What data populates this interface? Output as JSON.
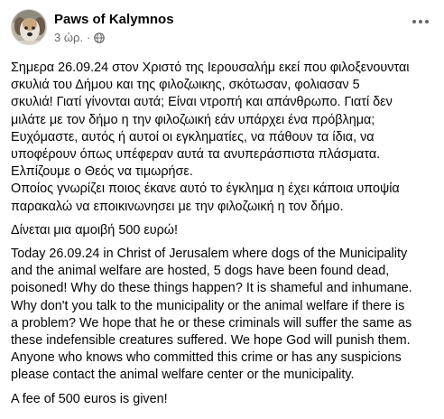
{
  "post": {
    "author": "Paws of Kalymnos",
    "time": "3 ώρ.",
    "separator": "·",
    "privacy_icon": "globe-icon",
    "more_icon": "more-options-icon",
    "paragraphs": [
      "Σημερα 26.09.24 στον Χριστό της Ιερουσαλήμ εκεί που φιλοξενουνται\nσκυλιά του Δήμου και της φιλοζωικης, σκότωσαν, φολιασαν 5\nσκυλιά! Γιατί γίνονται αυτά; Είναι ντροπή και απάνθρωπο. Γιατί δεν\nμιλάτε με τον δήμο η την φιλοζωική εάν υπάρχει ένα πρόβλημα;\nΕυχόμαστε, αυτός ή αυτοί οι εγκληματίες, να πάθουν τα ίδια, να\nυποφέρουν όπως υπέφεραν αυτά τα ανυπεράσπιστα πλάσματα.\nΕλπίζουμε ο Θεός να τιμωρήσε.\nΟποίος γνωρίζει ποιος έκανε αυτό το έγκλημα η έχει κάποια υποψία\nπαρακαλώ να εποικινωνησει με την φιλοζωική η τον δήμο.",
      "Δίνεται μια αμοιβή 500 ευρώ!",
      "Today 26.09.24 in Christ of Jerusalem where dogs of the Municipality\nand the animal welfare are hosted, 5 dogs have been found dead,\npoisoned! Why do these things happen? It is shameful and inhumane.\nWhy don't you talk to the municipality or the animal welfare if there is\na problem? We hope that he or these criminals will suffer the same as\nthese indefensible creatures suffered. We hope God will punish them.\nAnyone who knows who committed this crime or has any suspicions\nplease contact the animal welfare center or the municipality.",
      "A fee of 500 euros is given!"
    ]
  },
  "colors": {
    "text_primary": "#050505",
    "text_secondary": "#65676b",
    "background": "#ffffff"
  }
}
